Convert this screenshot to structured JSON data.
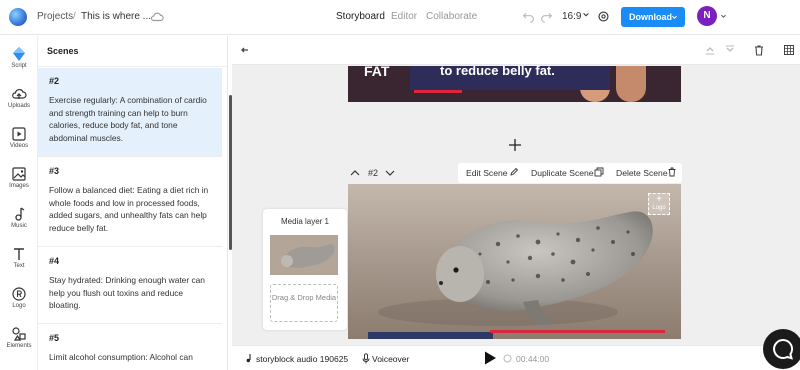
{
  "header": {
    "breadcrumb_projects": "Projects",
    "breadcrumb_sep": "/",
    "project_title": "This is where ...",
    "tabs": [
      {
        "label": "Storyboard",
        "active": true
      },
      {
        "label": "Editor",
        "active": false
      },
      {
        "label": "Collaborate",
        "active": false
      }
    ],
    "aspect_ratio": "16:9",
    "download_label": "Download",
    "avatar_initial": "N",
    "accent_color": "#1a8cf5"
  },
  "sidebar": {
    "items": [
      {
        "label": "Script",
        "icon": "script-icon",
        "active": true
      },
      {
        "label": "Uploads",
        "icon": "upload-cloud-icon"
      },
      {
        "label": "Videos",
        "icon": "video-icon"
      },
      {
        "label": "Images",
        "icon": "image-icon"
      },
      {
        "label": "Music",
        "icon": "music-icon"
      },
      {
        "label": "Text",
        "icon": "text-icon"
      },
      {
        "label": "Logo",
        "icon": "logo-registered-icon"
      },
      {
        "label": "Elements",
        "icon": "elements-icon"
      }
    ]
  },
  "scenes": {
    "title": "Scenes",
    "items": [
      {
        "num": "#2",
        "text": "Exercise regularly: A combination of cardio and strength training can help to burn calories, reduce body fat, and tone abdominal muscles.",
        "active": true
      },
      {
        "num": "#3",
        "text": "Follow a balanced diet: Eating a diet rich in whole foods and low in processed foods, added sugars, and unhealthy fats can help reduce belly fat."
      },
      {
        "num": "#4",
        "text": "Stay hydrated: Drinking enough water can help you flush out toxins and reduce bloating."
      },
      {
        "num": "#5",
        "text": "Limit alcohol consumption: Alcohol can"
      }
    ]
  },
  "canvas": {
    "previous_scene_text_left": "FAT",
    "previous_scene_text_right": "to reduce belly fat.",
    "scene_number": "#2",
    "edit_scene_label": "Edit Scene",
    "duplicate_scene_label": "Duplicate Scene",
    "delete_scene_label": "Delete Scene",
    "logo_placeholder": "Logo",
    "media_layer_title": "Media layer 1",
    "dropzone_label": "Drag & Drop Media"
  },
  "playback": {
    "audio_track": "storyblock audio 190625",
    "voiceover_label": "Voiceover",
    "timecode": "00:44:00"
  }
}
